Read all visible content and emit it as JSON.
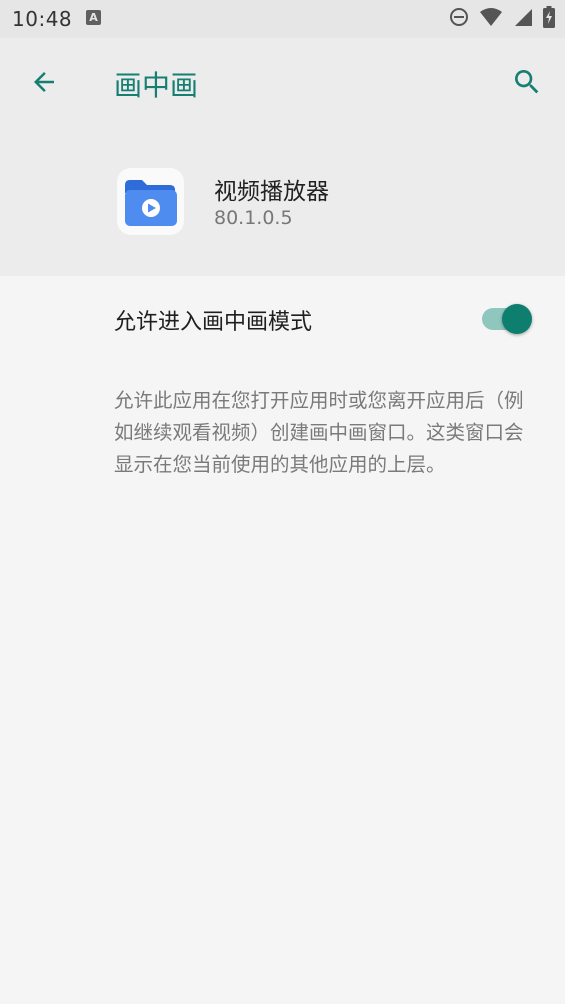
{
  "status_bar": {
    "time": "10:48",
    "notification_icon": "A",
    "icons": [
      "a-notification-icon",
      "do-not-disturb-icon",
      "wifi-icon",
      "signal-icon",
      "battery-charging-icon"
    ]
  },
  "header": {
    "title": "画中画",
    "back_icon": "arrow-back-icon",
    "search_icon": "search-icon"
  },
  "app": {
    "name": "视频播放器",
    "version": "80.1.0.5",
    "icon": "video-folder-icon"
  },
  "setting": {
    "label": "允许进入画中画模式",
    "enabled": true
  },
  "description": "允许此应用在您打开应用时或您离开应用后（例如继续观看视频）创建画中画窗口。这类窗口会显示在您当前使用的其他应用的上层。",
  "colors": {
    "accent": "#167f72",
    "toggle_thumb": "#0e7f6e",
    "toggle_track": "#8fc7be",
    "header_bg": "#ececec",
    "body_bg": "#f5f5f5",
    "status_bar_bg": "#e6e6e6"
  }
}
